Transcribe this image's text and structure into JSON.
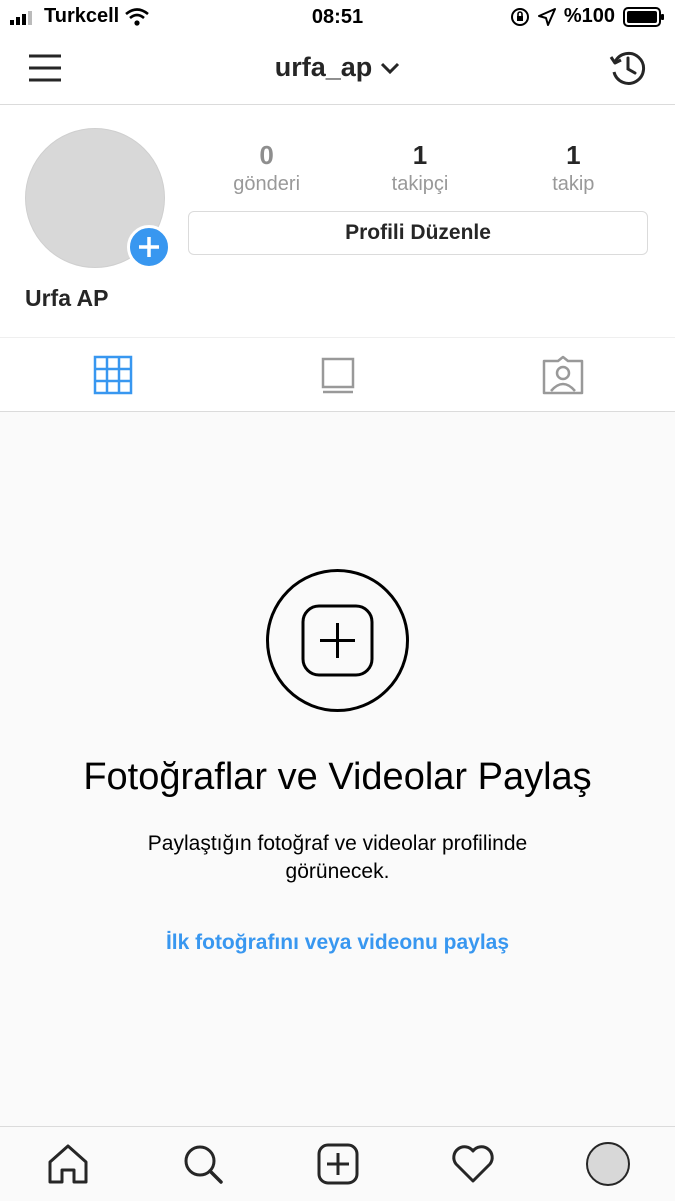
{
  "status_bar": {
    "carrier": "Turkcell",
    "time": "08:51",
    "battery": "%100",
    "icons": [
      "signal-icon",
      "wifi-icon",
      "orientation-lock-icon",
      "location-icon",
      "battery-icon"
    ]
  },
  "header": {
    "username": "urfa_ap",
    "icons": [
      "menu-icon",
      "chevron-down-icon",
      "history-icon"
    ]
  },
  "profile": {
    "stats": [
      {
        "value": "0",
        "label": "gönderi"
      },
      {
        "value": "1",
        "label": "takipçi"
      },
      {
        "value": "1",
        "label": "takip"
      }
    ],
    "edit_button": "Profili Düzenle",
    "display_name": "Urfa AP"
  },
  "tabs": [
    {
      "icon": "grid-icon",
      "active": true
    },
    {
      "icon": "feed-icon",
      "active": false
    },
    {
      "icon": "tagged-icon",
      "active": false
    }
  ],
  "empty_state": {
    "title": "Fotoğraflar ve Videolar Paylaş",
    "description": "Paylaştığın fotoğraf ve videolar profilinde görünecek.",
    "link": "İlk fotoğrafını veya videonu paylaş"
  },
  "tab_bar": [
    "home-icon",
    "search-icon",
    "new-post-icon",
    "activity-heart-icon",
    "profile-avatar"
  ],
  "colors": {
    "accent": "#3897f0",
    "text": "#262626",
    "muted": "#999999",
    "border": "#dbdbdb"
  }
}
